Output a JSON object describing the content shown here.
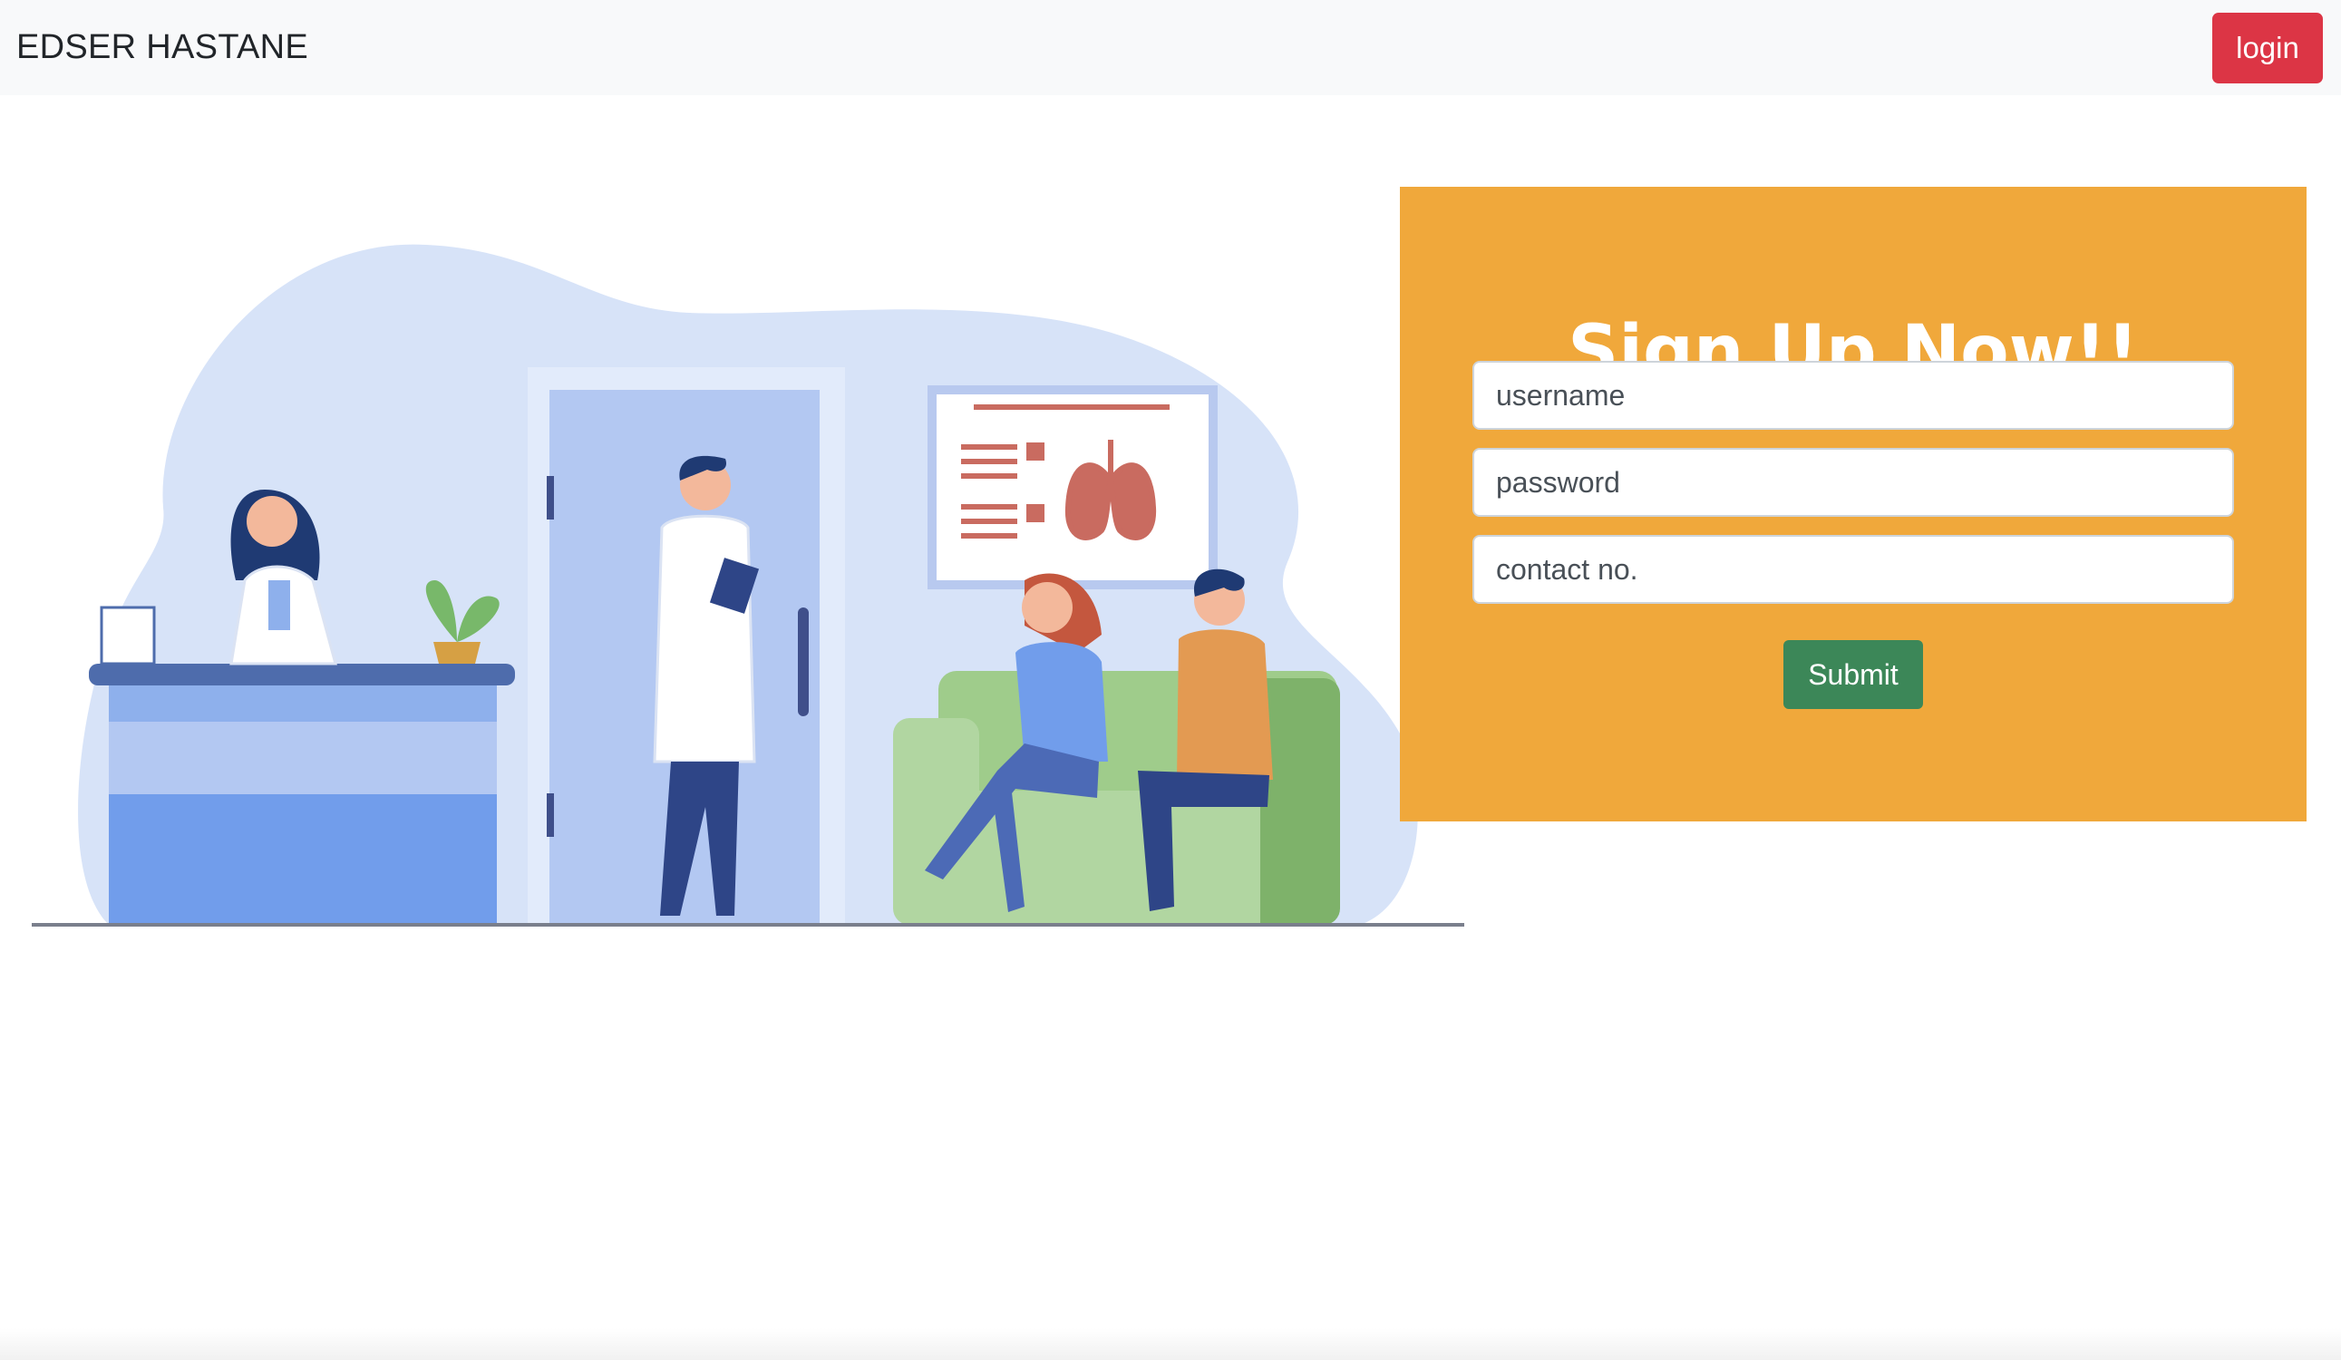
{
  "navbar": {
    "brand": "EDSER HASTANE",
    "login_label": "login"
  },
  "signup": {
    "title": "Sign Up Now!!",
    "username_placeholder": "username",
    "password_placeholder": "password",
    "contact_placeholder": "contact no.",
    "submit_label": "Submit"
  },
  "colors": {
    "panel": "#f0a83b",
    "login_button": "#dc3545",
    "submit_button": "#3c8758",
    "navbar_bg": "#f8f9fa"
  }
}
